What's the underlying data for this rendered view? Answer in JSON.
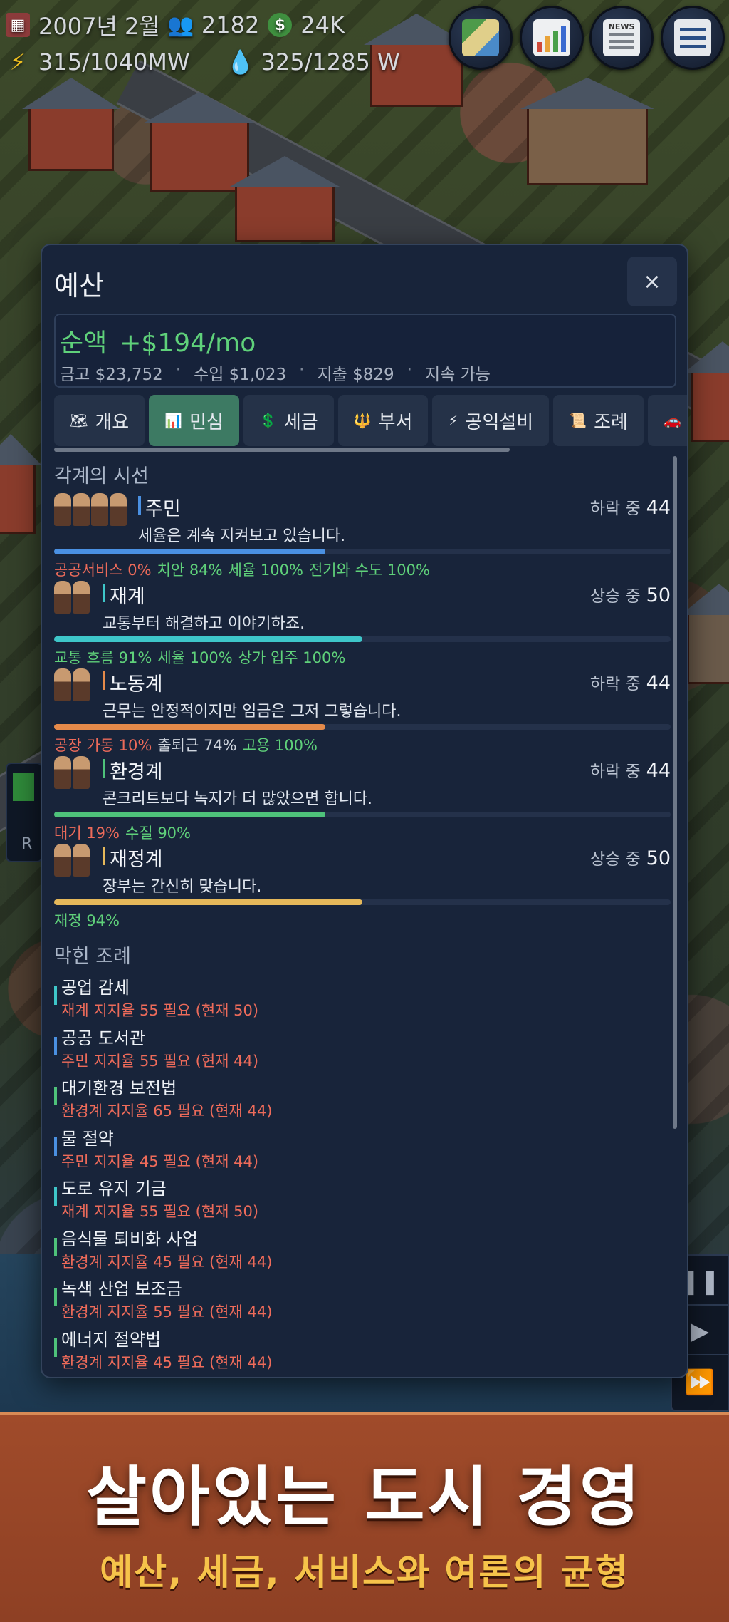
{
  "hud": {
    "date": "2007년 2월",
    "population": "2182",
    "money": "24K",
    "power": "315/1040MW",
    "water": "325/1285 W",
    "buttons": [
      "map-icon",
      "chart-icon",
      "news-icon",
      "list-icon"
    ],
    "news_label": "NEWS"
  },
  "panel": {
    "title": "예산",
    "close": "×",
    "summary": {
      "net_label": "순액",
      "net_value": "+$194/mo",
      "treasury": "금고 $23,752",
      "income": "수입 $1,023",
      "expense": "지출 $829",
      "status": "지속 가능",
      "sep": "·"
    },
    "tabs": [
      {
        "label": "개요",
        "icon": "🗺",
        "active": false
      },
      {
        "label": "민심",
        "icon": "📊",
        "active": true
      },
      {
        "label": "세금",
        "icon": "💲",
        "active": false
      },
      {
        "label": "부서",
        "icon": "🔱",
        "active": false
      },
      {
        "label": "공익설비",
        "icon": "⚡",
        "active": false
      },
      {
        "label": "조례",
        "icon": "📜",
        "active": false
      },
      {
        "label": "차",
        "icon": "🚗",
        "active": false
      }
    ],
    "opinion_header": "각계의 시선",
    "factions": [
      {
        "name": "주민",
        "quote": "세율은 계속 지켜보고 있습니다.",
        "trend": "하락 중",
        "score": "44",
        "value": 44,
        "color": "#4a90e2",
        "factors": [
          {
            "t": "공공서비스 0%",
            "s": "bad"
          },
          {
            "t": "치안 84%",
            "s": "good"
          },
          {
            "t": "세율 100%",
            "s": "good"
          },
          {
            "t": "전기와 수도 100%",
            "s": "good"
          }
        ]
      },
      {
        "name": "재계",
        "quote": "교통부터 해결하고 이야기하죠.",
        "trend": "상승 중",
        "score": "50",
        "value": 50,
        "color": "#3ec6c9",
        "factors": [
          {
            "t": "교통 흐름 91%",
            "s": "good"
          },
          {
            "t": "세율 100%",
            "s": "good"
          },
          {
            "t": "상가 입주 100%",
            "s": "good"
          }
        ]
      },
      {
        "name": "노동계",
        "quote": "근무는 안정적이지만 임금은 그저 그렇습니다.",
        "trend": "하락 중",
        "score": "44",
        "value": 44,
        "color": "#e58a4a",
        "factors": [
          {
            "t": "공장 가동 10%",
            "s": "bad"
          },
          {
            "t": "출퇴근 74%",
            "s": "mid"
          },
          {
            "t": "고용 100%",
            "s": "good"
          }
        ]
      },
      {
        "name": "환경계",
        "quote": "콘크리트보다 녹지가 더 많았으면 합니다.",
        "trend": "하락 중",
        "score": "44",
        "value": 44,
        "color": "#4ec27a",
        "factors": [
          {
            "t": "대기 19%",
            "s": "bad"
          },
          {
            "t": "수질 90%",
            "s": "good"
          }
        ]
      },
      {
        "name": "재정계",
        "quote": "장부는 간신히 맞습니다.",
        "trend": "상승 중",
        "score": "50",
        "value": 50,
        "color": "#e5b85a",
        "factors": [
          {
            "t": "재정 94%",
            "s": "good"
          }
        ]
      }
    ],
    "blocked_header": "막힌 조례",
    "ordinances": [
      {
        "name": "공업 감세",
        "req": "재계 지지율 55 필요 (현재 50)",
        "color": "#3ec6c9"
      },
      {
        "name": "공공 도서관",
        "req": "주민 지지율 55 필요 (현재 44)",
        "color": "#4a90e2"
      },
      {
        "name": "대기환경 보전법",
        "req": "환경계 지지율 65 필요 (현재 44)",
        "color": "#4ec27a"
      },
      {
        "name": "물 절약",
        "req": "주민 지지율 45 필요 (현재 44)",
        "color": "#4a90e2"
      },
      {
        "name": "도로 유지 기금",
        "req": "재계 지지율 55 필요 (현재 50)",
        "color": "#3ec6c9"
      },
      {
        "name": "음식물 퇴비화 사업",
        "req": "환경계 지지율 45 필요 (현재 44)",
        "color": "#4ec27a"
      },
      {
        "name": "녹색 산업 보조금",
        "req": "환경계 지지율 55 필요 (현재 44)",
        "color": "#4ec27a"
      },
      {
        "name": "에너지 절약법",
        "req": "환경계 지지율 45 필요 (현재 44)",
        "color": "#4ec27a"
      }
    ]
  },
  "side": {
    "left_letter": "R"
  },
  "controls": {
    "play": "▶",
    "fast": "⏩"
  },
  "banner": {
    "headline": "살아있는 도시 경영",
    "subline": "예산, 세금, 서비스와 여론의 균형"
  }
}
